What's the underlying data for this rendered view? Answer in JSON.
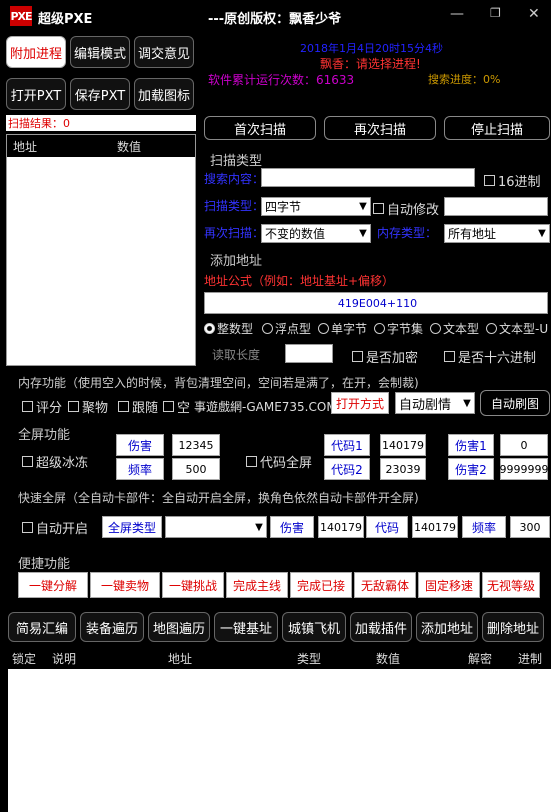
{
  "app": {
    "logo": "PXE",
    "title": "超级PXE",
    "subtitle": "---原创版权：飘香少爷"
  },
  "tabs": [
    "附加进程",
    "编辑模式",
    "调交意见",
    "打开PXT",
    "保存PXT",
    "加载图标"
  ],
  "status": {
    "datetime": "2018年1月4日20时15分4秒",
    "hint": "飘香：请选择进程!",
    "run_count": "软件累计运行次数：61633",
    "search_progress": "搜索进度：0%"
  },
  "scan": {
    "result_label": "扫描结果：0",
    "col_address": "地址",
    "col_value": "数值",
    "first_scan": "首次扫描",
    "next_scan": "再次扫描",
    "stop_scan": "停止扫描"
  },
  "scan_type": {
    "group": "扫描类型",
    "search_content": "搜索内容：",
    "hex16": "16进制",
    "scan_type_label": "扫描类型：",
    "scan_type_value": "四字节",
    "auto_modify": "自动修改",
    "rescan_label": "再次扫描：",
    "rescan_value": "不变的数值",
    "mem_type_label": "内存类型：",
    "mem_type_value": "所有地址"
  },
  "add_addr": {
    "group": "添加地址",
    "formula_label": "地址公式（例如：地址基址+偏移）",
    "formula_value": "419E004+110",
    "radios": [
      "整数型",
      "浮点型",
      "单字节",
      "字节集",
      "文本型",
      "文本型-U"
    ],
    "read_len": "读取长度",
    "encrypted": "是否加密",
    "hex16": "是否十六进制"
  },
  "memory": {
    "title": "内存功能（使用空入的时候，背包清理空间，空间若是满了，在开，会制裁)",
    "checks": [
      "评分",
      "聚物",
      "跟随",
      "空"
    ],
    "watermark": "事遊戲網-GAME735.COM",
    "open_way": "打开方式",
    "auto_plot": "自动剧情",
    "auto_map": "自动刷图"
  },
  "fullscreen": {
    "title": "全屏功能",
    "super_freeze": "超级冰冻",
    "harm": "伤害",
    "harm_val": "12345",
    "freq": "频率",
    "freq_val": "500",
    "code_full": "代码全屏",
    "code1": "代码1",
    "code1_val": "140179",
    "code2": "代码2",
    "code2_val": "23039",
    "harm1": "伤害1",
    "harm1_val": "0",
    "harm2": "伤害2",
    "harm2_val": "9999999"
  },
  "quick": {
    "title": "快速全屏（全自动卡部件：全自动开启全屏，换角色依然自动卡部件开全屏)",
    "auto_open": "自动开启",
    "type_btn": "全屏类型",
    "harm": "伤害",
    "harm_val": "140179",
    "code": "代码",
    "code_val": "140179",
    "freq": "频率",
    "freq_val": "300"
  },
  "convenient": {
    "title": "便捷功能",
    "buttons": [
      "一键分解",
      "一键卖物",
      "一键挑战",
      "完成主线",
      "完成已接",
      "无敌霸体",
      "固定移速",
      "无视等级"
    ]
  },
  "bottom_buttons": [
    "简易汇编",
    "装备遍历",
    "地图遍历",
    "一键基址",
    "城镇飞机",
    "加载插件",
    "添加地址",
    "删除地址"
  ],
  "table": {
    "cols": [
      "锁定",
      "说明",
      "地址",
      "类型",
      "数值",
      "解密",
      "进制"
    ]
  }
}
